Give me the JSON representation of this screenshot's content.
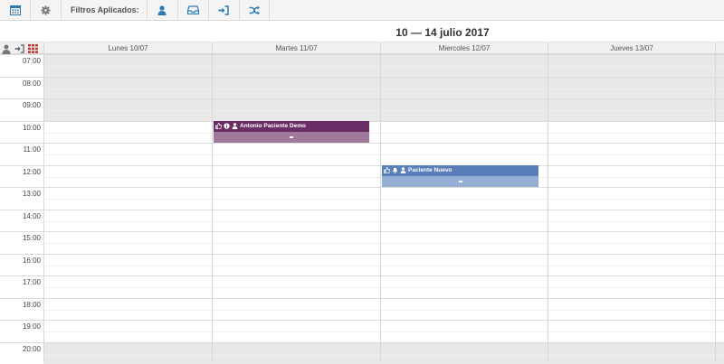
{
  "toolbar": {
    "buttons": [
      {
        "name": "calendar-icon",
        "color": "#2a7ab8"
      },
      {
        "name": "gear-icon",
        "color": "#777777"
      }
    ],
    "filters_label": "Filtros Aplicados:",
    "filters": [
      {
        "name": "user-filter-icon",
        "color": "#2a7ab8"
      },
      {
        "name": "inbox-filter-icon",
        "color": "#2a7ab8"
      },
      {
        "name": "sign-in-filter-icon",
        "color": "#2a7ab8"
      },
      {
        "name": "random-filter-icon",
        "color": "#2a7ab8"
      }
    ]
  },
  "title": "10 — 14 julio 2017",
  "header": {
    "icons": [
      "user-icon",
      "sign-in-icon",
      "grid-icon"
    ],
    "days": [
      "Lunes 10/07",
      "Martes 11/07",
      "Miercoles 12/07",
      "Jueves 13/07"
    ]
  },
  "hours": [
    "07:00",
    "08:00",
    "09:00",
    "10:00",
    "11:00",
    "12:00",
    "13:00",
    "14:00",
    "15:00",
    "16:00",
    "17:00",
    "18:00",
    "19:00",
    "20:00"
  ],
  "shaded_hours": [
    "07:00",
    "08:00",
    "09:00",
    "20:00"
  ],
  "events": [
    {
      "title": "Antonio Paciente Demo",
      "day": "Martes 11/07",
      "start": "10:00",
      "color": "#6b2d66",
      "body_color": "#a0789c",
      "body": "-"
    },
    {
      "title": "Paciente Nuevo",
      "day": "Miercoles 12/07",
      "start": "12:00",
      "color": "#5a7fb8",
      "body_color": "#95aed4",
      "body": "-"
    }
  ]
}
